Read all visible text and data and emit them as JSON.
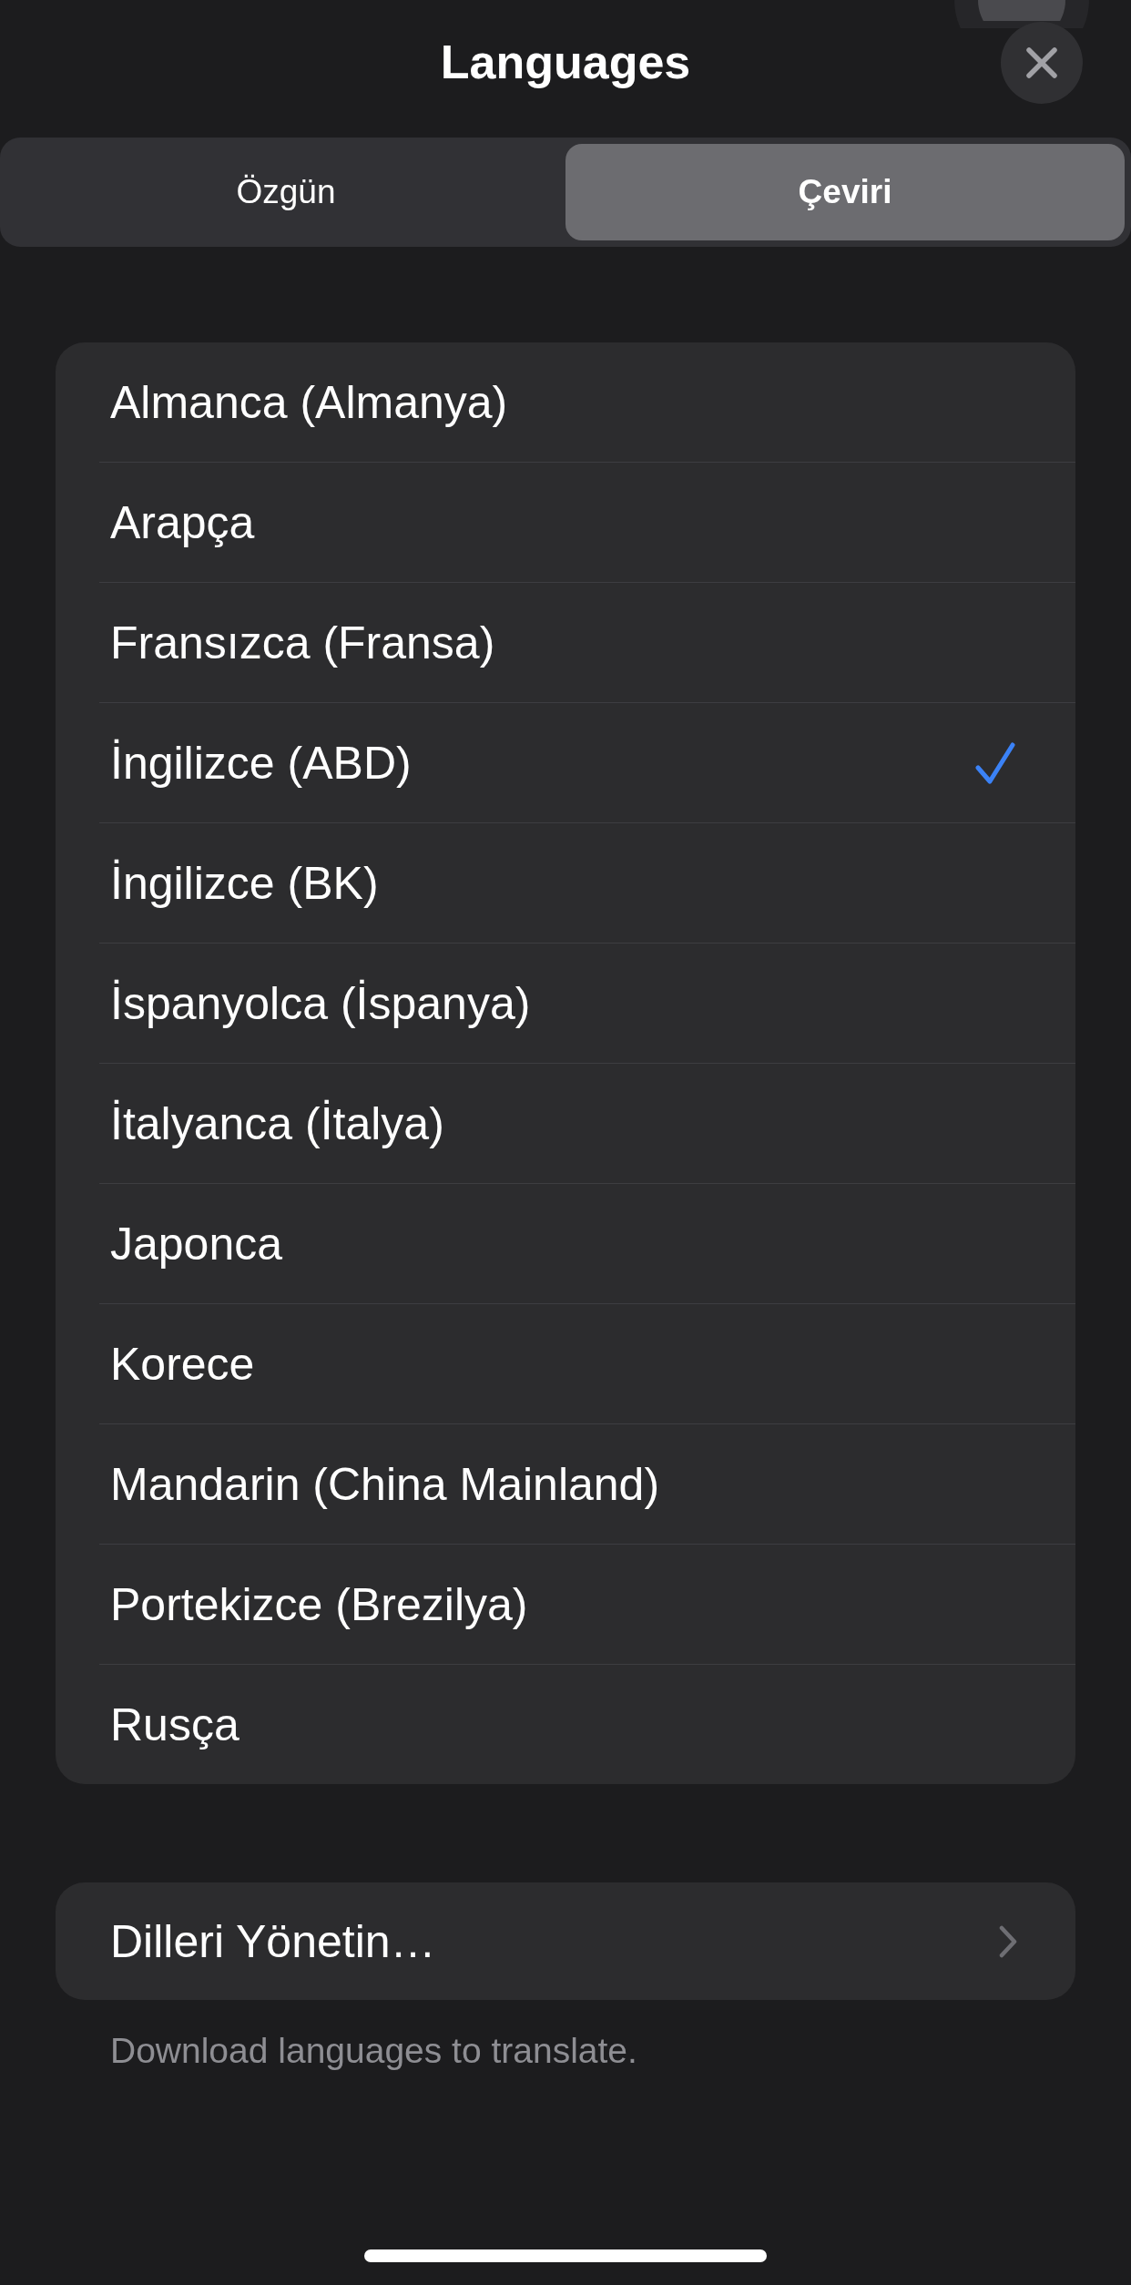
{
  "header": {
    "title": "Languages"
  },
  "segments": [
    {
      "label": "Özgün",
      "selected": false
    },
    {
      "label": "Çeviri",
      "selected": true
    }
  ],
  "languages": [
    {
      "name": "Almanca (Almanya)",
      "selected": false
    },
    {
      "name": "Arapça",
      "selected": false
    },
    {
      "name": "Fransızca (Fransa)",
      "selected": false
    },
    {
      "name": "İngilizce (ABD)",
      "selected": true
    },
    {
      "name": "İngilizce (BK)",
      "selected": false
    },
    {
      "name": "İspanyolca (İspanya)",
      "selected": false
    },
    {
      "name": "İtalyanca (İtalya)",
      "selected": false
    },
    {
      "name": "Japonca",
      "selected": false
    },
    {
      "name": "Korece",
      "selected": false
    },
    {
      "name": "Mandarin (China Mainland)",
      "selected": false
    },
    {
      "name": "Portekizce (Brezilya)",
      "selected": false
    },
    {
      "name": "Rusça",
      "selected": false
    }
  ],
  "manage": {
    "label": "Dilleri Yönetin…"
  },
  "footer": "Download languages to translate."
}
